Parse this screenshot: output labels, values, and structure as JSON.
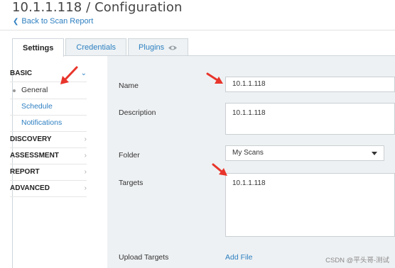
{
  "page": {
    "title": "10.1.1.118 / Configuration",
    "back_link": "Back to Scan Report"
  },
  "tabs": [
    {
      "label": "Settings",
      "active": true
    },
    {
      "label": "Credentials",
      "active": false
    },
    {
      "label": "Plugins",
      "active": false,
      "icon": "eye-icon"
    }
  ],
  "sidebar": {
    "sections": [
      {
        "label": "BASIC",
        "expanded": true,
        "items": [
          {
            "label": "General",
            "current": true
          },
          {
            "label": "Schedule",
            "current": false
          },
          {
            "label": "Notifications",
            "current": false
          }
        ]
      },
      {
        "label": "DISCOVERY",
        "expanded": false
      },
      {
        "label": "ASSESSMENT",
        "expanded": false
      },
      {
        "label": "REPORT",
        "expanded": false
      },
      {
        "label": "ADVANCED",
        "expanded": false
      }
    ]
  },
  "form": {
    "name_label": "Name",
    "name_value": "10.1.1.118",
    "description_label": "Description",
    "description_value": "10.1.1.118",
    "folder_label": "Folder",
    "folder_value": "My Scans",
    "targets_label": "Targets",
    "targets_value": "10.1.1.118",
    "upload_label": "Upload Targets",
    "add_file": "Add File"
  },
  "colors": {
    "link": "#2d7fc1",
    "annotation_arrow": "#e8352b",
    "content_bg": "#eef1f3"
  },
  "watermark": "CSDN @平头哥-测试"
}
